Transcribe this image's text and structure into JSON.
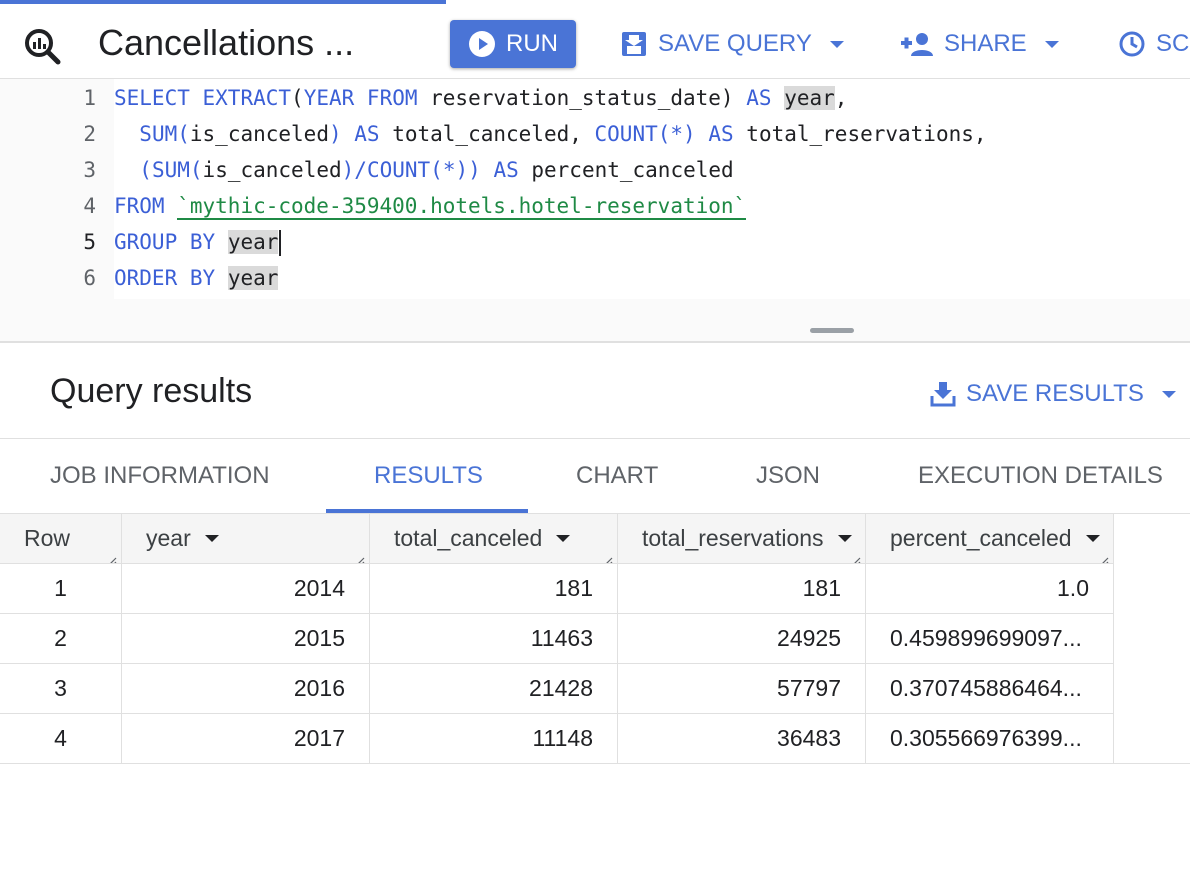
{
  "toolbar": {
    "title": "Cancellations ...",
    "run_label": "RUN",
    "save_query_label": "SAVE QUERY",
    "share_label": "SHARE",
    "schedule_label": "SC"
  },
  "editor": {
    "line_numbers": [
      "1",
      "2",
      "3",
      "4",
      "5",
      "6"
    ],
    "active_line": "5",
    "lines": [
      "SELECT EXTRACT(YEAR FROM reservation_status_date) AS year,",
      "  SUM(is_canceled) AS total_canceled, COUNT(*) AS total_reservations,",
      "  (SUM(is_canceled)/COUNT(*)) AS percent_canceled",
      "FROM `mythic-code-359400.hotels.hotel-reservation`",
      "GROUP BY year",
      "ORDER BY year"
    ]
  },
  "results": {
    "title": "Query results",
    "save_results_label": "SAVE RESULTS",
    "tabs": [
      "JOB INFORMATION",
      "RESULTS",
      "CHART",
      "JSON",
      "EXECUTION DETAILS"
    ],
    "active_tab": "RESULTS",
    "columns": [
      "Row",
      "year",
      "total_canceled",
      "total_reservations",
      "percent_canceled"
    ],
    "rows": [
      [
        "1",
        "2014",
        "181",
        "181",
        "1.0"
      ],
      [
        "2",
        "2015",
        "11463",
        "24925",
        "0.459899699097..."
      ],
      [
        "3",
        "2016",
        "21428",
        "57797",
        "0.370745886464..."
      ],
      [
        "4",
        "2017",
        "11148",
        "36483",
        "0.305566976399..."
      ]
    ]
  },
  "colors": {
    "accent": "#4a74d6",
    "keyword": "#3b5fd6",
    "string": "#1f8a45"
  },
  "icons": {
    "logo": "bigquery-search-icon",
    "run": "play-circle-icon",
    "save_query": "save-icon",
    "share": "add-person-icon",
    "schedule": "clock-icon",
    "save_results": "download-icon"
  }
}
